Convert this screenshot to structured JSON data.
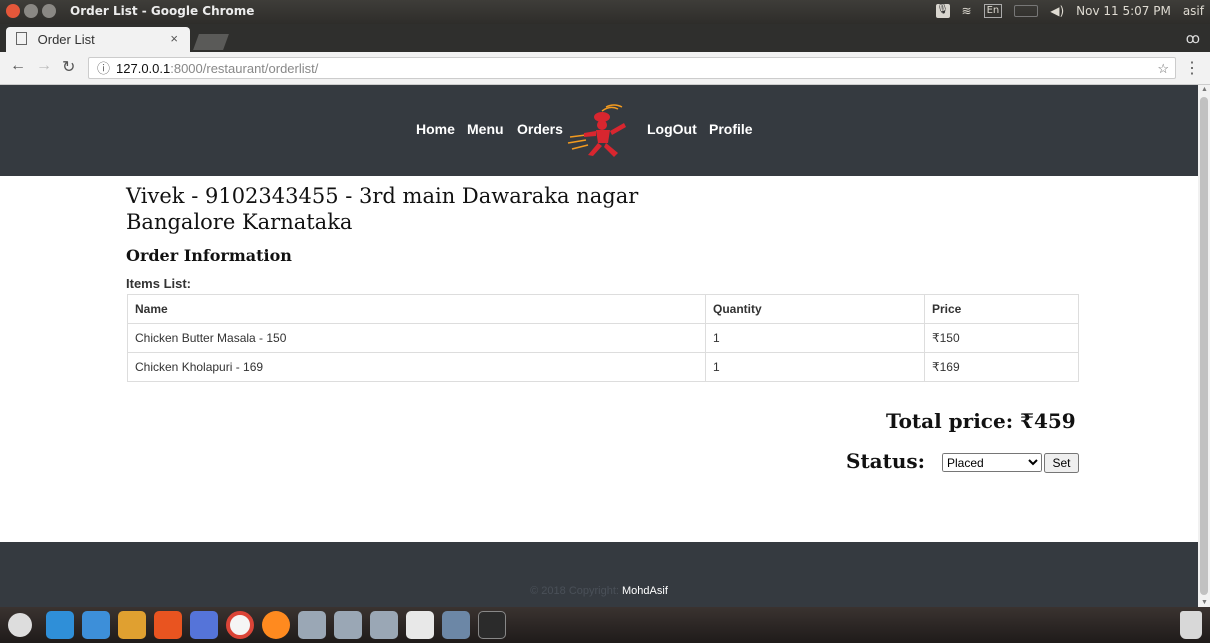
{
  "system": {
    "window_title": "Order List - Google Chrome",
    "tray": {
      "lang": "En",
      "datetime": "Nov 11  5:07 PM",
      "user": "asif"
    }
  },
  "browser": {
    "tab_title": "Order List",
    "tab_close": "×",
    "url_host": "127.0.0.1",
    "url_path": ":8000/restaurant/orderlist/"
  },
  "nav": {
    "home": "Home",
    "menu": "Menu",
    "orders": "Orders",
    "logout": "LogOut",
    "profile": "Profile"
  },
  "order": {
    "customer_line": "Vivek - 9102343455 - 3rd main Dawaraka nagar Bangalore Karnataka",
    "section_title": "Order Information",
    "items_label": "Items List:",
    "columns": [
      "Name",
      "Quantity",
      "Price"
    ],
    "items": [
      {
        "name": "Chicken Butter Masala - 150",
        "quantity": "1",
        "price": "₹150"
      },
      {
        "name": "Chicken Kholapuri - 169",
        "quantity": "1",
        "price": "₹169"
      }
    ],
    "total": "Total price: ₹459",
    "status_label": "Status:",
    "status_value": "Placed",
    "set_label": "Set"
  },
  "footer": {
    "copyright": "© 2018 Copyright:",
    "author": "MohdAsif"
  },
  "colors": {
    "nav_bg": "#353a40",
    "logo_red": "#d8262f",
    "logo_orange": "#f29a1f"
  }
}
